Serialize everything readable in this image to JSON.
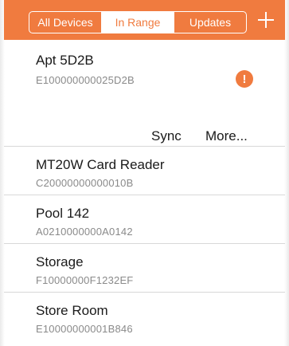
{
  "header": {
    "segments": [
      "All Devices",
      "In Range",
      "Updates"
    ],
    "selected_segment": "In Range",
    "add_icon": "plus-icon",
    "color": "#f07b3f"
  },
  "expanded_device": {
    "name": "Apt 5D2B",
    "id": "E100000000025D2B",
    "alert_symbol": "!",
    "actions": {
      "sync": "Sync",
      "more": "More..."
    }
  },
  "devices": [
    {
      "name": "MT20W Card Reader",
      "id": "C20000000000010B"
    },
    {
      "name": "Pool 142",
      "id": "A0210000000A0142"
    },
    {
      "name": "Storage",
      "id": "F10000000F1232EF"
    },
    {
      "name": "Store Room",
      "id": "E10000000001B846"
    }
  ]
}
